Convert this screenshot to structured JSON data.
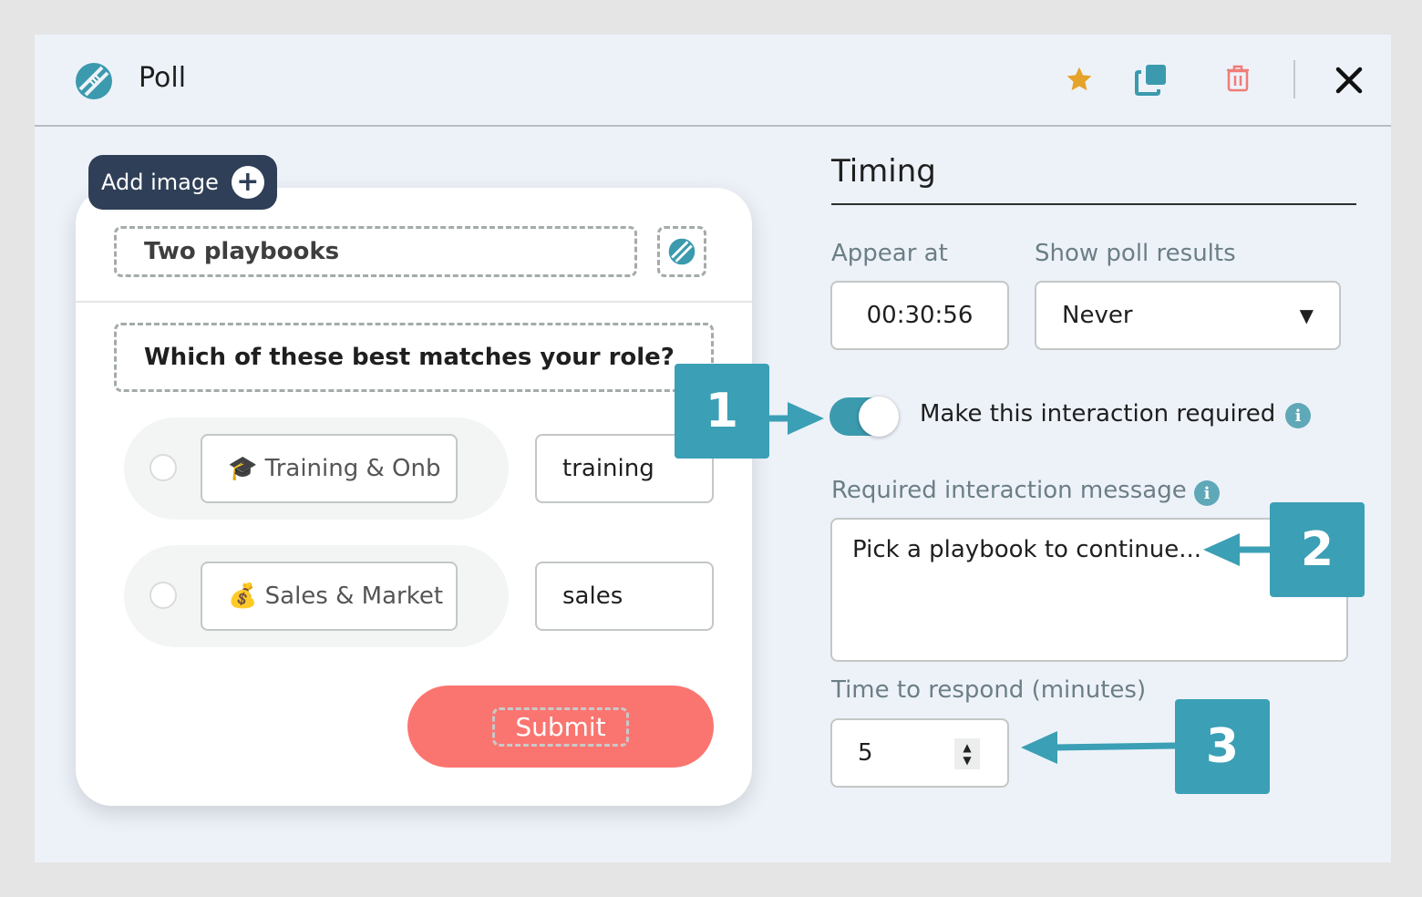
{
  "header": {
    "title": "Poll",
    "logo_icon": "football-icon",
    "star_icon": "star-icon",
    "copy_icon": "duplicate-icon",
    "trash_icon": "trash-icon",
    "close_icon": "close-icon"
  },
  "card": {
    "add_image_label": "Add image",
    "poll_name": "Two playbooks",
    "question": "Which of these best matches your role?",
    "options": [
      {
        "emoji": "🎓",
        "label": "Training & Onb",
        "value": "training"
      },
      {
        "emoji": "💰",
        "label": "Sales & Market",
        "value": "sales"
      }
    ],
    "submit_label": "Submit"
  },
  "timing": {
    "title": "Timing",
    "appear_at_label": "Appear at",
    "appear_at_value": "00:30:56",
    "show_results_label": "Show poll results",
    "show_results_value": "Never",
    "required_toggle_on": true,
    "required_label": "Make this interaction required",
    "required_message_label": "Required interaction message",
    "required_message_value": "Pick a playbook to continue...",
    "time_to_respond_label": "Time to respond (minutes)",
    "time_to_respond_value": "5"
  },
  "callouts": [
    "1",
    "2",
    "3"
  ],
  "colors": {
    "accent": "#3b9fb5",
    "submit": "#fb7570",
    "add_image_bg": "#2f3f57",
    "star": "#e5a329",
    "trash": "#f07c78"
  }
}
